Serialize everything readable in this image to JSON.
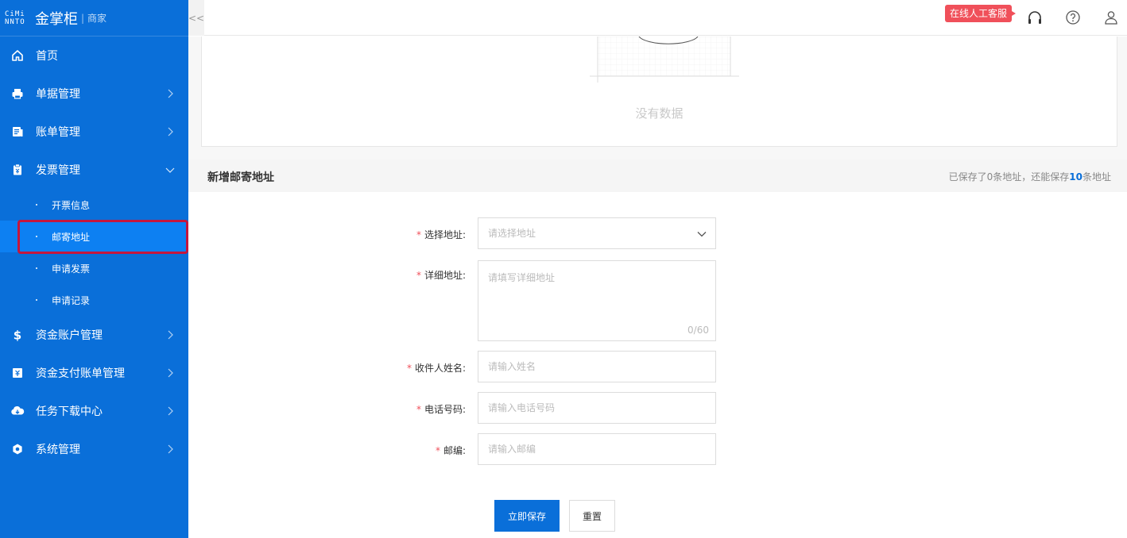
{
  "brand": {
    "logo_mark_top": "CiMi",
    "logo_mark_bottom": "NNTO",
    "name": "金掌柜",
    "separator": "|",
    "role": "商家"
  },
  "sidebar": {
    "items": [
      {
        "label": "首页",
        "icon": "home-icon"
      },
      {
        "label": "单据管理",
        "icon": "printer-icon"
      },
      {
        "label": "账单管理",
        "icon": "bill-icon"
      },
      {
        "label": "发票管理",
        "icon": "invoice-icon",
        "expanded": true
      },
      {
        "label": "资金账户管理",
        "icon": "dollar-icon"
      },
      {
        "label": "资金支付账单管理",
        "icon": "payment-bill-icon"
      },
      {
        "label": "任务下载中心",
        "icon": "cloud-download-icon"
      },
      {
        "label": "系统管理",
        "icon": "settings-icon"
      }
    ],
    "invoice_submenu": [
      "开票信息",
      "邮寄地址",
      "申请发票",
      "申请记录"
    ],
    "active_submenu": "邮寄地址"
  },
  "header": {
    "collapse_glyph": "<<",
    "service_badge": "在线人工客服",
    "icons": [
      "headset-icon",
      "help-icon",
      "user-icon"
    ]
  },
  "empty": {
    "text": "没有数据"
  },
  "section": {
    "title": "新增邮寄地址",
    "info_prefix": "已保存了0条地址，还能保存",
    "info_count": "10",
    "info_suffix": "条地址"
  },
  "form": {
    "required_mark": "*",
    "address_select": {
      "label": "选择地址:",
      "placeholder": "请选择地址"
    },
    "detail_address": {
      "label": "详细地址:",
      "placeholder": "请填写详细地址",
      "counter": "0/60"
    },
    "recipient_name": {
      "label": "收件人姓名:",
      "placeholder": "请输入姓名"
    },
    "phone": {
      "label": "电话号码:",
      "placeholder": "请输入电话号码"
    },
    "postcode": {
      "label": "邮编:",
      "placeholder": "请输入邮编"
    },
    "save_button": "立即保存",
    "reset_button": "重置"
  },
  "colors": {
    "sidebar_bg": "#0a6fd9",
    "active_item_bg": "#0d80f2",
    "highlight_border": "#c4163d",
    "badge_bg": "#f0505a"
  }
}
